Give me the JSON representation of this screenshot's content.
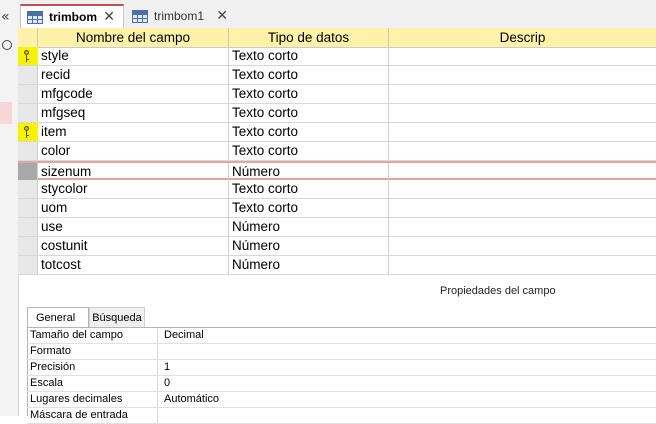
{
  "tabs": [
    {
      "label": "trimbom",
      "active": true
    },
    {
      "label": "trimbom1",
      "active": false
    }
  ],
  "grid": {
    "headers": [
      "Nombre del campo",
      "Tipo de datos",
      "Descrip"
    ],
    "rows": [
      {
        "name": "style",
        "type": "Texto corto",
        "key": true
      },
      {
        "name": "recid",
        "type": "Texto corto",
        "key": false
      },
      {
        "name": "mfgcode",
        "type": "Texto corto",
        "key": false
      },
      {
        "name": "mfgseq",
        "type": "Texto corto",
        "key": false
      },
      {
        "name": "item",
        "type": "Texto corto",
        "key": true
      },
      {
        "name": "color",
        "type": "Texto corto",
        "key": false
      },
      {
        "name": "sizenum",
        "type": "Número",
        "key": false,
        "current": true
      },
      {
        "name": "stycolor",
        "type": "Texto corto",
        "key": false
      },
      {
        "name": "uom",
        "type": "Texto corto",
        "key": false
      },
      {
        "name": "use",
        "type": "Número",
        "key": false
      },
      {
        "name": "costunit",
        "type": "Número",
        "key": false
      },
      {
        "name": "totcost",
        "type": "Número",
        "key": false
      }
    ],
    "accent_color": "#fff2a8",
    "key_highlight_color": "#f6f300"
  },
  "field_properties": {
    "title": "Propiedades del campo",
    "tabs": [
      "General",
      "Búsqueda"
    ],
    "rows": [
      {
        "label": "Tamaño del campo",
        "value": "Decimal"
      },
      {
        "label": "Formato",
        "value": ""
      },
      {
        "label": "Precisión",
        "value": "1"
      },
      {
        "label": "Escala",
        "value": "0"
      },
      {
        "label": "Lugares decimales",
        "value": "Automático"
      },
      {
        "label": "Máscara de entrada",
        "value": ""
      }
    ]
  },
  "icons": {
    "nav_collapse": "chevron-double-left-icon",
    "search": "search-icon",
    "key": "primary-key-icon",
    "table": "table-icon",
    "close": "close-icon"
  }
}
